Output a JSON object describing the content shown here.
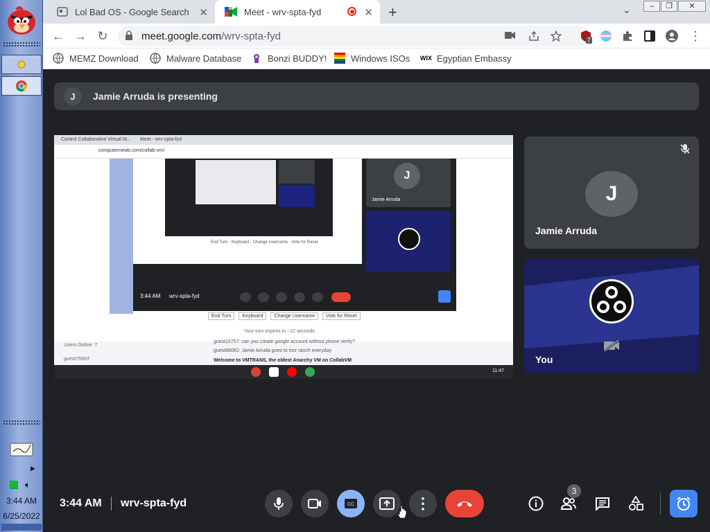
{
  "taskbar": {
    "clock_time": "3:44 AM",
    "clock_date": "6/25/2022",
    "start_icon": "angry-bird-icon"
  },
  "tabs": [
    {
      "title": "Lol Bad OS - Google Search",
      "icon": "google-icon",
      "active": false
    },
    {
      "title": "Meet - wrv-spta-fyd",
      "icon": "meet-icon",
      "active": true,
      "recording": true
    }
  ],
  "window_controls": {
    "minimize": "–",
    "restore": "❐",
    "close": "✕"
  },
  "address_bar": {
    "url_host": "meet.google.com",
    "url_path": "/wrv-spta-fyd",
    "extension_badge": "7"
  },
  "bookmarks": [
    {
      "label": "MEMZ Download",
      "icon": "globe-icon"
    },
    {
      "label": "Malware Database",
      "icon": "globe-icon"
    },
    {
      "label": "Bonzi BUDDY!",
      "icon": "bonzi-icon"
    },
    {
      "label": "Windows ISOs",
      "icon": "windows-icon"
    },
    {
      "label": "Egyptian Embassy",
      "icon": "wix-icon"
    }
  ],
  "presenting": {
    "initial": "J",
    "text": "Jamie Arruda is presenting"
  },
  "screen_share": {
    "tab1": "Control Collaborative Virtual M...",
    "tab2": "Meet - wrv-spta-fyd",
    "url": "computernewb.com/collab-vm/",
    "inner_time": "3:44 AM",
    "inner_code": "wrv-spta-fyd",
    "inner_tile_name": "Jamie Arruda",
    "buttons": [
      "End Turn",
      "Keyboard",
      "Change Username",
      "Vote for Reset"
    ],
    "turn_text": "Your turn expires in ~12 seconds",
    "users_online": "Users Online: 7",
    "guest_user": "guest75993",
    "chat": [
      "guest15757: can you create google account without phone verify?",
      "guest88082: Jamie Arruda goes to mcr ranch everyday",
      "Welcome to VMTRANS, the oldest Anarchy VM on CollabVM"
    ],
    "shelf_time": "11:47"
  },
  "participants": [
    {
      "name": "Jamie Arruda",
      "initial": "J",
      "muted": true
    },
    {
      "name": "You",
      "camera_off": true
    }
  ],
  "controls": {
    "time": "3:44 AM",
    "meeting_code": "wrv-spta-fyd",
    "people_count": "3"
  }
}
